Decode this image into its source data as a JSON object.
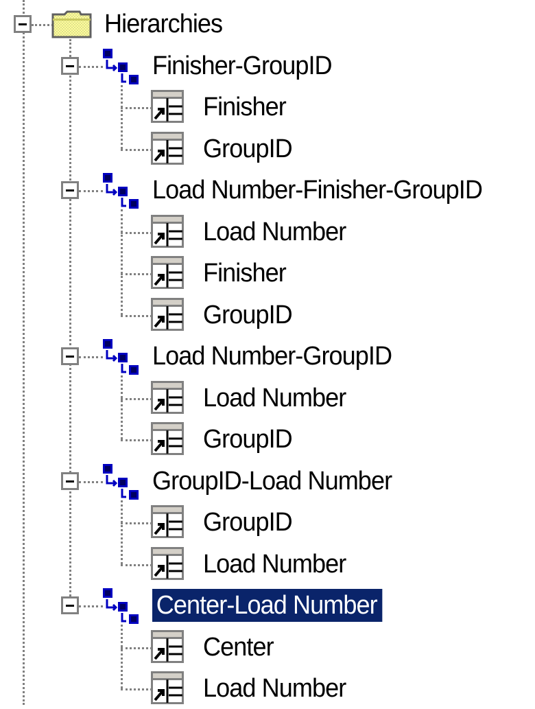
{
  "tree": {
    "root": {
      "label": "Hierarchies",
      "icon": "folder-icon",
      "expanded": true
    },
    "hierarchies": [
      {
        "label": "Finisher-GroupID",
        "icon": "hierarchy-icon",
        "expanded": true,
        "selected": false,
        "levels": [
          {
            "label": "Finisher",
            "icon": "level-icon"
          },
          {
            "label": "GroupID",
            "icon": "level-icon"
          }
        ]
      },
      {
        "label": "Load Number-Finisher-GroupID",
        "icon": "hierarchy-icon",
        "expanded": true,
        "selected": false,
        "levels": [
          {
            "label": "Load Number",
            "icon": "level-icon"
          },
          {
            "label": "Finisher",
            "icon": "level-icon"
          },
          {
            "label": "GroupID",
            "icon": "level-icon"
          }
        ]
      },
      {
        "label": "Load Number-GroupID",
        "icon": "hierarchy-icon",
        "expanded": true,
        "selected": false,
        "levels": [
          {
            "label": "Load Number",
            "icon": "level-icon"
          },
          {
            "label": "GroupID",
            "icon": "level-icon"
          }
        ]
      },
      {
        "label": "GroupID-Load Number",
        "icon": "hierarchy-icon",
        "expanded": true,
        "selected": false,
        "levels": [
          {
            "label": "GroupID",
            "icon": "level-icon"
          },
          {
            "label": "Load Number",
            "icon": "level-icon"
          }
        ]
      },
      {
        "label": "Center-Load Number",
        "icon": "hierarchy-icon",
        "expanded": true,
        "selected": true,
        "levels": [
          {
            "label": "Center",
            "icon": "level-icon"
          },
          {
            "label": "Load Number",
            "icon": "level-icon"
          }
        ]
      }
    ]
  },
  "colors": {
    "selection_bg": "#0a246a",
    "selection_text": "#ffffff",
    "tree_lines": "#808080",
    "folder_yellow": "#ffff99",
    "icon_blue": "#0000c0"
  }
}
